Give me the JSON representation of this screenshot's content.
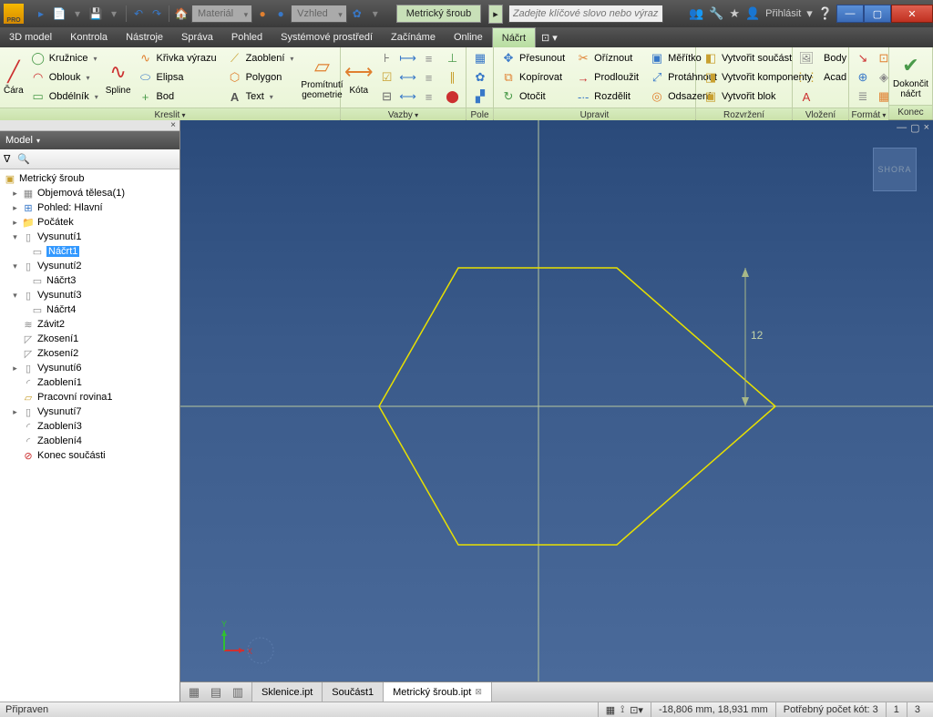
{
  "title_tab": "Metrický šroub",
  "title_tab_small": "▸",
  "logo_text": "PRO",
  "material_dd": "Materiál",
  "appearance_dd": "Vzhled",
  "search_placeholder": "Zadejte klíčové slovo nebo výraz.",
  "signin": "Přihlásit",
  "menu": {
    "m0": "3D model",
    "m1": "Kontrola",
    "m2": "Nástroje",
    "m3": "Správa",
    "m4": "Pohled",
    "m5": "Systémové prostředí",
    "m6": "Začínáme",
    "m7": "Online",
    "m8": "Náčrt",
    "m9": "⊡ ▾"
  },
  "ribbon": {
    "kreslit": {
      "cara": "Čára",
      "spline": "Spline",
      "kruznice": "Kružnice",
      "oblouk": "Oblouk",
      "obdelnik": "Obdélník",
      "krivka": "Křivka výrazu",
      "elipsa": "Elipsa",
      "bod": "Bod",
      "zaobleni": "Zaoblení",
      "polygon": "Polygon",
      "text": "Text",
      "promitnout": "Promítnutí\ngeometrie",
      "label": "Kreslit"
    },
    "kota": {
      "kota": "Kóta",
      "label": "Vazby"
    },
    "pole": {
      "label": "Pole"
    },
    "upravit": {
      "presunout": "Přesunout",
      "kopirovat": "Kopírovat",
      "otocit": "Otočit",
      "oriznout": "Oříznout",
      "prodlouzit": "Prodloužit",
      "rozdelit": "Rozdělit",
      "meritko": "Měřítko",
      "protahnout": "Protáhnout",
      "odsazeni": "Odsazení",
      "label": "Upravit"
    },
    "rozvrz": {
      "soucast": "Vytvořit součást",
      "komponenty": "Vytvořit komponenty",
      "blok": "Vytvořit blok",
      "label": "Rozvržení"
    },
    "vloz": {
      "body": "Body",
      "acad": "Acad",
      "label": "Vložení"
    },
    "format": {
      "label": "Formát"
    },
    "konec": {
      "dokoncit": "Dokončit\nnáčrt",
      "label": "Konec"
    }
  },
  "browser": {
    "hdr": "Model"
  },
  "tree": {
    "root": "Metrický šroub",
    "telesa": "Objemová tělesa(1)",
    "pohled": "Pohled: Hlavní",
    "pocatek": "Počátek",
    "v1": "Vysunutí1",
    "n1": "Náčrt1",
    "v2": "Vysunutí2",
    "n3": "Náčrt3",
    "v3": "Vysunutí3",
    "n4": "Náčrt4",
    "zavit": "Závit2",
    "zk1": "Zkosení1",
    "zk2": "Zkosení2",
    "v6": "Vysunutí6",
    "za1": "Zaoblení1",
    "rov": "Pracovní rovina1",
    "v7": "Vysunutí7",
    "za3": "Zaoblení3",
    "za4": "Zaoblení4",
    "konec": "Konec součásti"
  },
  "viewcube": "SHORA",
  "dim_value": "12",
  "doctabs": {
    "t0": "Sklenice.ipt",
    "t1": "Součást1",
    "t2": "Metrický šroub.ipt"
  },
  "status": {
    "ready": "Připraven",
    "coords": "-18,806 mm, 18,931 mm",
    "kot": "Potřebný počet kót: 3",
    "n1": "1",
    "n2": "3"
  }
}
